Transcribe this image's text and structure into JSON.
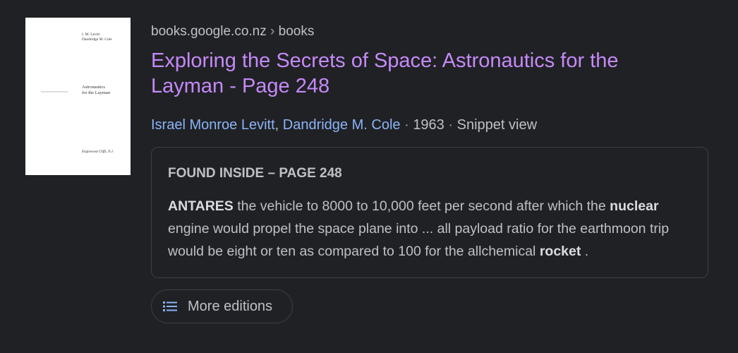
{
  "book": {
    "cover": {
      "authors_line1": "I. M. Levitt",
      "authors_line2": "Dandridge M. Cole",
      "title_line1": "Astronautics",
      "title_line2": "for the Layman",
      "place": "Englewood Cliffs, N.J."
    },
    "cite": {
      "domain": "books.google.co.nz",
      "separator": "›",
      "path": "books"
    },
    "title": "Exploring the Secrets of Space: Astronautics for the Layman - Page 248",
    "author1": "Israel Monroe Levitt",
    "author_sep": ",",
    "author2": "Dandridge M. Cole",
    "dot": "·",
    "year": "1963",
    "view": "Snippet view"
  },
  "snippet": {
    "found_label": "FOUND INSIDE",
    "found_dash": "–",
    "found_page": "PAGE 248",
    "t1_bold": "ANTARES",
    "t1": " the vehicle to 8000 to 10,000 feet per second after which the ",
    "t2_bold": "nuclear",
    "t3": " engine would propel the space plane into ... all payload ratio for the earthmoon trip would be eight or ten as compared to 100 for the allchemical ",
    "t4_bold": "rocket",
    "t5": " ."
  },
  "more_editions": {
    "label": "More editions",
    "icon": "list-icon"
  }
}
